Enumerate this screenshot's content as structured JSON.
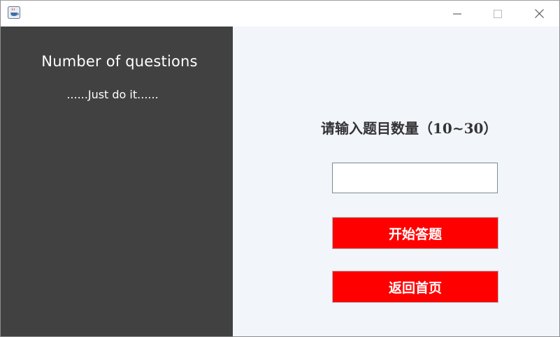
{
  "titlebar": {
    "icons": {
      "app": "java-app-icon",
      "minimize": "minimize-icon",
      "maximize": "maximize-icon",
      "close": "close-icon"
    }
  },
  "left_panel": {
    "title": "Number of questions",
    "subtitle": "......Just do it......"
  },
  "right_panel": {
    "prompt": "请输入题目数量（10~30）",
    "count_input": {
      "value": "",
      "placeholder": ""
    },
    "start_button_label": "开始答题",
    "back_button_label": "返回首页"
  },
  "colors": {
    "left_panel_bg": "#414141",
    "right_panel_bg": "#f2f5fa",
    "button_bg": "#ff0000",
    "button_text": "#ffffff"
  }
}
